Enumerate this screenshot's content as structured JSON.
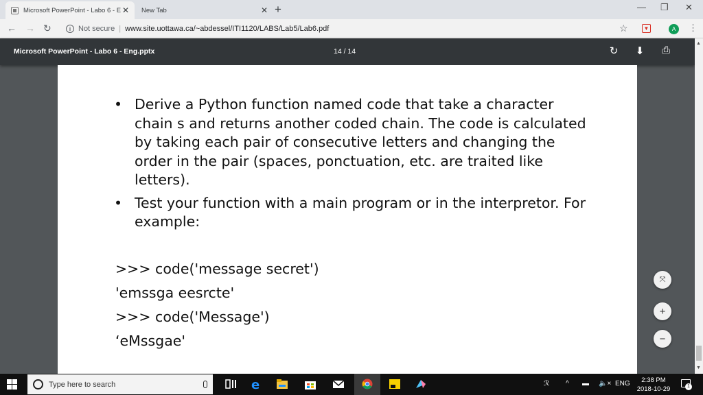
{
  "tabs": [
    {
      "title": "Microsoft PowerPoint - Labo 6 - E"
    },
    {
      "title": "New Tab"
    }
  ],
  "address": {
    "security": "Not secure",
    "url": "www.site.uottawa.ca/~abdessel/ITI1120/LABS/Lab5/Lab6.pdf"
  },
  "profile": {
    "initial": "A"
  },
  "pdf": {
    "title": "Microsoft PowerPoint - Labo 6 - Eng.pptx",
    "page_indicator": "14 / 14"
  },
  "slide": {
    "bullets": [
      "Derive a Python function named code that take a character chain s and returns another coded chain. The code is calculated by taking each pair of consecutive letters and changing the order in the pair (spaces, ponctuation, etc. are traited like letters).",
      "Test your function with a main program or in the interpretor. For example:"
    ],
    "code": [
      ">>> code('message secret')",
      "'emssga eesrcte'",
      ">>> code('Message')",
      "‘eMssgae'"
    ]
  },
  "taskbar": {
    "search_placeholder": "Type here to search",
    "language": "ENG",
    "time": "2:38 PM",
    "date": "2018-10-29",
    "notification_count": "1"
  }
}
